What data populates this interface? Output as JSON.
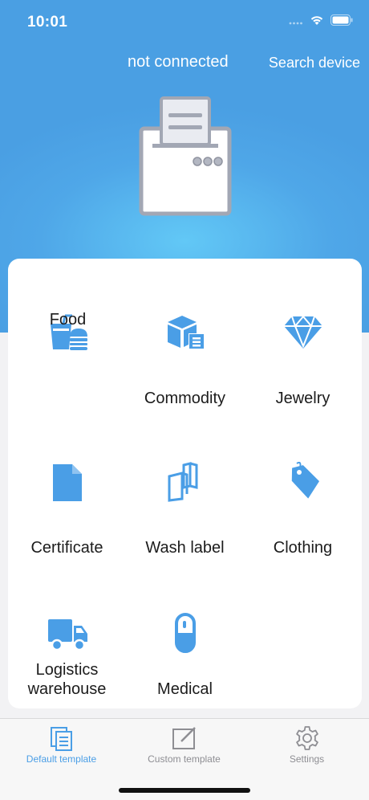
{
  "status_bar": {
    "time": "10:01"
  },
  "header": {
    "connection_status": "not connected",
    "search_label": "Search device"
  },
  "categories": [
    {
      "label": "Food",
      "icon": "food-drink-icon"
    },
    {
      "label": "Commodity",
      "icon": "package-icon"
    },
    {
      "label": "Jewelry",
      "icon": "diamond-icon"
    },
    {
      "label": "Certificate",
      "icon": "document-icon"
    },
    {
      "label": "Wash label",
      "icon": "label-tag-icon"
    },
    {
      "label": "Clothing",
      "icon": "price-tag-icon"
    },
    {
      "label": "Logistics\nwarehouse",
      "icon": "truck-icon"
    },
    {
      "label": "Medical",
      "icon": "capsule-icon"
    }
  ],
  "tabs": [
    {
      "label": "Default template",
      "icon": "default-template-icon",
      "active": true
    },
    {
      "label": "Custom template",
      "icon": "edit-template-icon",
      "active": false
    },
    {
      "label": "Settings",
      "icon": "gear-icon",
      "active": false
    }
  ],
  "colors": {
    "accent": "#4a9ee6",
    "hero_bg": "#4fa7e8",
    "hero_glow": "#62c8f6",
    "active_tab": "#4a9ee6",
    "inactive_tab": "#8e8e93"
  }
}
